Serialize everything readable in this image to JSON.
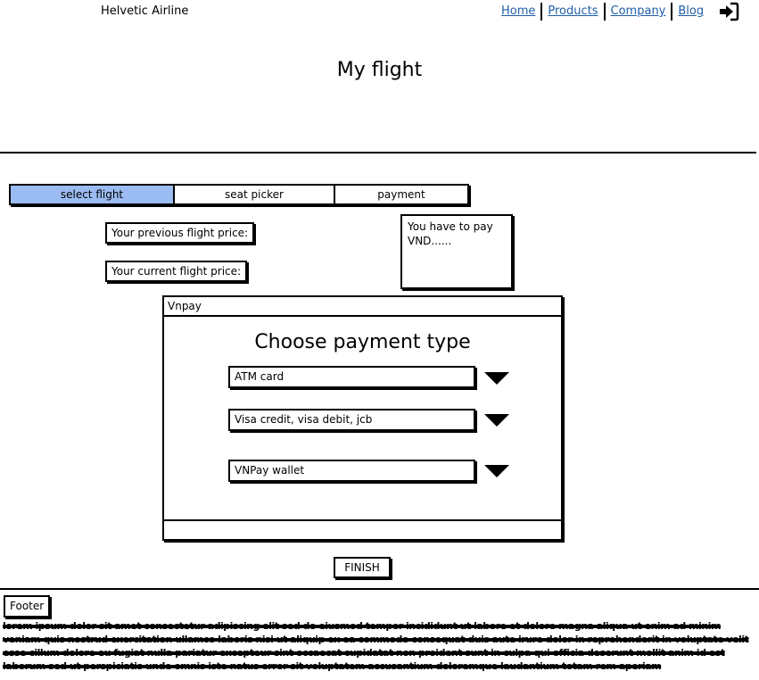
{
  "header": {
    "brand": "Helvetic Airline",
    "nav": [
      {
        "label": "Home"
      },
      {
        "label": "Products"
      },
      {
        "label": "Company"
      },
      {
        "label": "Blog"
      }
    ],
    "login_icon": "sign-in-icon"
  },
  "page": {
    "title": "My flight"
  },
  "stepper": {
    "steps": [
      {
        "label": "select flight",
        "active": true
      },
      {
        "label": "seat picker",
        "active": false
      },
      {
        "label": "payment",
        "active": false
      }
    ],
    "active_color": "#9bbcf2"
  },
  "prices": {
    "previous_label": "Your previous flight price:",
    "current_label": "Your current flight price:"
  },
  "pay_note": {
    "text": "You have to pay VND......"
  },
  "payment_window": {
    "title": "Vnpay",
    "heading": "Choose payment type",
    "options": [
      {
        "value": "ATM card"
      },
      {
        "value": "Visa credit, visa debit, jcb"
      },
      {
        "value": "VNPay wallet"
      }
    ],
    "dropdown_icon": "triangle-down-icon"
  },
  "actions": {
    "finish_label": "FINISH"
  },
  "footer": {
    "label": "Footer",
    "text": "lorem ipsum dolor sit amet consectetur adipiscing elit sed do eiusmod tempor incididunt ut labore et dolore magna aliqua ut enim ad minim veniam quis nostrud exercitation ullamco laboris nisi ut aliquip ex ea commodo consequat duis aute irure dolor in reprehenderit in voluptate velit esse cillum dolore eu fugiat nulla pariatur excepteur sint occaecat cupidatat non proident sunt in culpa qui officia deserunt mollit anim id est laborum sed ut perspiciatis unde omnis iste natus error sit voluptatem accusantium doloremque laudantium totam rem aperiam"
  }
}
